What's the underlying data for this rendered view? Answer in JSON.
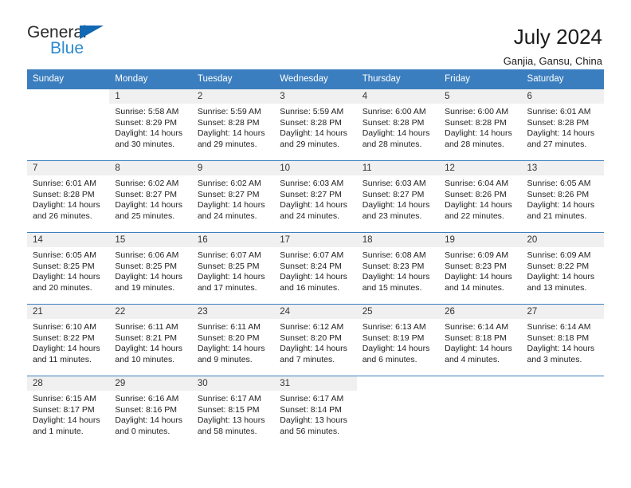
{
  "brand": {
    "name_top": "General",
    "name_bottom": "Blue",
    "triangle_color": "#1268b3",
    "blue_color": "#2e8bd0"
  },
  "header": {
    "title": "July 2024",
    "subtitle": "Ganjia, Gansu, China"
  },
  "theme": {
    "header_bg": "#3b7ebf",
    "daynum_bg": "#f0f0f0",
    "grid_line": "#3b7ebf"
  },
  "weekdays": [
    "Sunday",
    "Monday",
    "Tuesday",
    "Wednesday",
    "Thursday",
    "Friday",
    "Saturday"
  ],
  "weeks": [
    [
      {
        "day": "",
        "blank": true,
        "sunrise": "",
        "sunset": "",
        "daylight1": "",
        "daylight2": ""
      },
      {
        "day": "1",
        "sunrise": "Sunrise: 5:58 AM",
        "sunset": "Sunset: 8:29 PM",
        "daylight1": "Daylight: 14 hours",
        "daylight2": "and 30 minutes."
      },
      {
        "day": "2",
        "sunrise": "Sunrise: 5:59 AM",
        "sunset": "Sunset: 8:28 PM",
        "daylight1": "Daylight: 14 hours",
        "daylight2": "and 29 minutes."
      },
      {
        "day": "3",
        "sunrise": "Sunrise: 5:59 AM",
        "sunset": "Sunset: 8:28 PM",
        "daylight1": "Daylight: 14 hours",
        "daylight2": "and 29 minutes."
      },
      {
        "day": "4",
        "sunrise": "Sunrise: 6:00 AM",
        "sunset": "Sunset: 8:28 PM",
        "daylight1": "Daylight: 14 hours",
        "daylight2": "and 28 minutes."
      },
      {
        "day": "5",
        "sunrise": "Sunrise: 6:00 AM",
        "sunset": "Sunset: 8:28 PM",
        "daylight1": "Daylight: 14 hours",
        "daylight2": "and 28 minutes."
      },
      {
        "day": "6",
        "sunrise": "Sunrise: 6:01 AM",
        "sunset": "Sunset: 8:28 PM",
        "daylight1": "Daylight: 14 hours",
        "daylight2": "and 27 minutes."
      }
    ],
    [
      {
        "day": "7",
        "sunrise": "Sunrise: 6:01 AM",
        "sunset": "Sunset: 8:28 PM",
        "daylight1": "Daylight: 14 hours",
        "daylight2": "and 26 minutes."
      },
      {
        "day": "8",
        "sunrise": "Sunrise: 6:02 AM",
        "sunset": "Sunset: 8:27 PM",
        "daylight1": "Daylight: 14 hours",
        "daylight2": "and 25 minutes."
      },
      {
        "day": "9",
        "sunrise": "Sunrise: 6:02 AM",
        "sunset": "Sunset: 8:27 PM",
        "daylight1": "Daylight: 14 hours",
        "daylight2": "and 24 minutes."
      },
      {
        "day": "10",
        "sunrise": "Sunrise: 6:03 AM",
        "sunset": "Sunset: 8:27 PM",
        "daylight1": "Daylight: 14 hours",
        "daylight2": "and 24 minutes."
      },
      {
        "day": "11",
        "sunrise": "Sunrise: 6:03 AM",
        "sunset": "Sunset: 8:27 PM",
        "daylight1": "Daylight: 14 hours",
        "daylight2": "and 23 minutes."
      },
      {
        "day": "12",
        "sunrise": "Sunrise: 6:04 AM",
        "sunset": "Sunset: 8:26 PM",
        "daylight1": "Daylight: 14 hours",
        "daylight2": "and 22 minutes."
      },
      {
        "day": "13",
        "sunrise": "Sunrise: 6:05 AM",
        "sunset": "Sunset: 8:26 PM",
        "daylight1": "Daylight: 14 hours",
        "daylight2": "and 21 minutes."
      }
    ],
    [
      {
        "day": "14",
        "sunrise": "Sunrise: 6:05 AM",
        "sunset": "Sunset: 8:25 PM",
        "daylight1": "Daylight: 14 hours",
        "daylight2": "and 20 minutes."
      },
      {
        "day": "15",
        "sunrise": "Sunrise: 6:06 AM",
        "sunset": "Sunset: 8:25 PM",
        "daylight1": "Daylight: 14 hours",
        "daylight2": "and 19 minutes."
      },
      {
        "day": "16",
        "sunrise": "Sunrise: 6:07 AM",
        "sunset": "Sunset: 8:25 PM",
        "daylight1": "Daylight: 14 hours",
        "daylight2": "and 17 minutes."
      },
      {
        "day": "17",
        "sunrise": "Sunrise: 6:07 AM",
        "sunset": "Sunset: 8:24 PM",
        "daylight1": "Daylight: 14 hours",
        "daylight2": "and 16 minutes."
      },
      {
        "day": "18",
        "sunrise": "Sunrise: 6:08 AM",
        "sunset": "Sunset: 8:23 PM",
        "daylight1": "Daylight: 14 hours",
        "daylight2": "and 15 minutes."
      },
      {
        "day": "19",
        "sunrise": "Sunrise: 6:09 AM",
        "sunset": "Sunset: 8:23 PM",
        "daylight1": "Daylight: 14 hours",
        "daylight2": "and 14 minutes."
      },
      {
        "day": "20",
        "sunrise": "Sunrise: 6:09 AM",
        "sunset": "Sunset: 8:22 PM",
        "daylight1": "Daylight: 14 hours",
        "daylight2": "and 13 minutes."
      }
    ],
    [
      {
        "day": "21",
        "sunrise": "Sunrise: 6:10 AM",
        "sunset": "Sunset: 8:22 PM",
        "daylight1": "Daylight: 14 hours",
        "daylight2": "and 11 minutes."
      },
      {
        "day": "22",
        "sunrise": "Sunrise: 6:11 AM",
        "sunset": "Sunset: 8:21 PM",
        "daylight1": "Daylight: 14 hours",
        "daylight2": "and 10 minutes."
      },
      {
        "day": "23",
        "sunrise": "Sunrise: 6:11 AM",
        "sunset": "Sunset: 8:20 PM",
        "daylight1": "Daylight: 14 hours",
        "daylight2": "and 9 minutes."
      },
      {
        "day": "24",
        "sunrise": "Sunrise: 6:12 AM",
        "sunset": "Sunset: 8:20 PM",
        "daylight1": "Daylight: 14 hours",
        "daylight2": "and 7 minutes."
      },
      {
        "day": "25",
        "sunrise": "Sunrise: 6:13 AM",
        "sunset": "Sunset: 8:19 PM",
        "daylight1": "Daylight: 14 hours",
        "daylight2": "and 6 minutes."
      },
      {
        "day": "26",
        "sunrise": "Sunrise: 6:14 AM",
        "sunset": "Sunset: 8:18 PM",
        "daylight1": "Daylight: 14 hours",
        "daylight2": "and 4 minutes."
      },
      {
        "day": "27",
        "sunrise": "Sunrise: 6:14 AM",
        "sunset": "Sunset: 8:18 PM",
        "daylight1": "Daylight: 14 hours",
        "daylight2": "and 3 minutes."
      }
    ],
    [
      {
        "day": "28",
        "sunrise": "Sunrise: 6:15 AM",
        "sunset": "Sunset: 8:17 PM",
        "daylight1": "Daylight: 14 hours",
        "daylight2": "and 1 minute."
      },
      {
        "day": "29",
        "sunrise": "Sunrise: 6:16 AM",
        "sunset": "Sunset: 8:16 PM",
        "daylight1": "Daylight: 14 hours",
        "daylight2": "and 0 minutes."
      },
      {
        "day": "30",
        "sunrise": "Sunrise: 6:17 AM",
        "sunset": "Sunset: 8:15 PM",
        "daylight1": "Daylight: 13 hours",
        "daylight2": "and 58 minutes."
      },
      {
        "day": "31",
        "sunrise": "Sunrise: 6:17 AM",
        "sunset": "Sunset: 8:14 PM",
        "daylight1": "Daylight: 13 hours",
        "daylight2": "and 56 minutes."
      },
      {
        "day": "",
        "blank": true,
        "sunrise": "",
        "sunset": "",
        "daylight1": "",
        "daylight2": ""
      },
      {
        "day": "",
        "blank": true,
        "sunrise": "",
        "sunset": "",
        "daylight1": "",
        "daylight2": ""
      },
      {
        "day": "",
        "blank": true,
        "sunrise": "",
        "sunset": "",
        "daylight1": "",
        "daylight2": ""
      }
    ]
  ]
}
